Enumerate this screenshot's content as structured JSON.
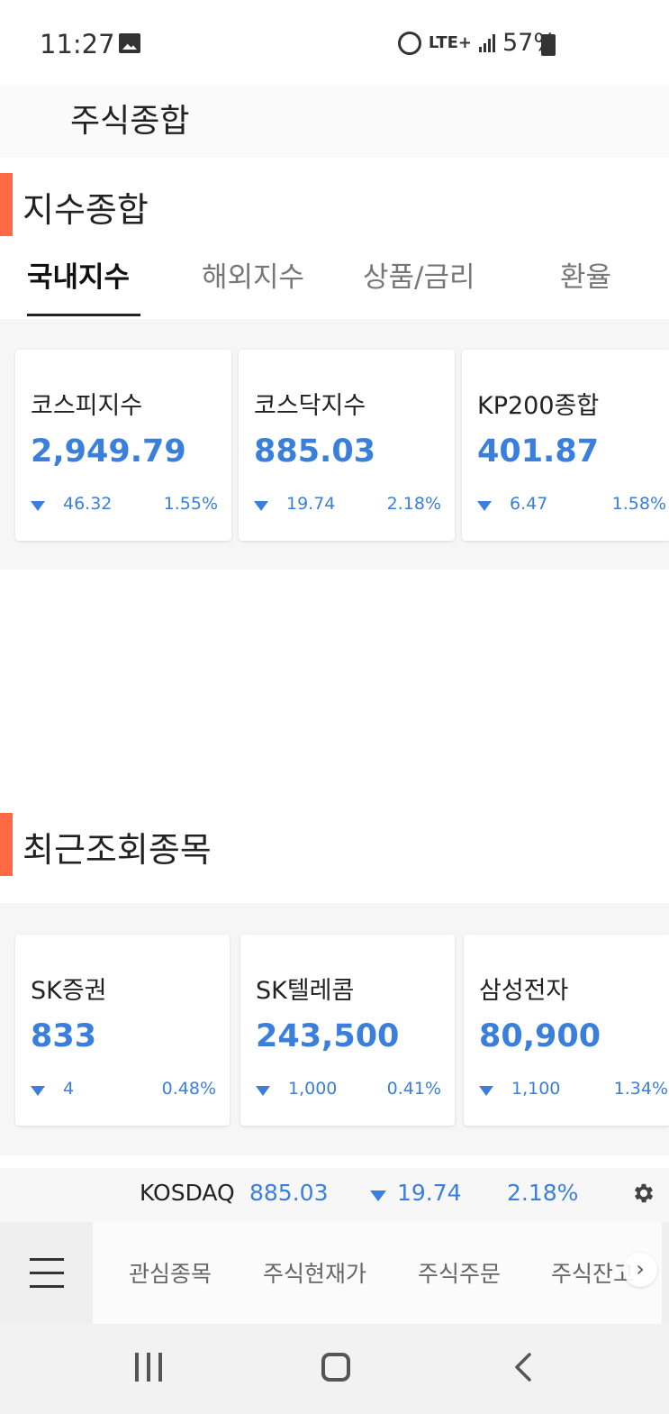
{
  "status_bar": {
    "time": "11:27",
    "network": "LTE+",
    "battery": "57%"
  },
  "header": {
    "title": "주식종합"
  },
  "index_section": {
    "title": "지수종합",
    "tabs": [
      "국내지수",
      "해외지수",
      "상품/금리",
      "환율"
    ],
    "active_tab": 0,
    "cards": [
      {
        "name": "코스피지수",
        "value": "2,949.79",
        "change": "46.32",
        "percent": "1.55%"
      },
      {
        "name": "코스닥지수",
        "value": "885.03",
        "change": "19.74",
        "percent": "2.18%"
      },
      {
        "name": "KP200종합",
        "value": "401.87",
        "change": "6.47",
        "percent": "1.58%"
      }
    ]
  },
  "recent_section": {
    "title": "최근조회종목",
    "cards": [
      {
        "name": "SK증권",
        "value": "833",
        "change": "4",
        "percent": "0.48%"
      },
      {
        "name": "SK텔레콤",
        "value": "243,500",
        "change": "1,000",
        "percent": "0.41%"
      },
      {
        "name": "삼성전자",
        "value": "80,900",
        "change": "1,100",
        "percent": "1.34%"
      }
    ]
  },
  "ticker": {
    "name": "KOSDAQ",
    "value": "885.03",
    "change": "19.74",
    "percent": "2.18%"
  },
  "bottom_nav": {
    "items": [
      "관심종목",
      "주식현재가",
      "주식주문",
      "주식잔고"
    ],
    "more_arrow": "›"
  },
  "colors": {
    "accent": "#ff6a45",
    "down_blue": "#3a7fdc"
  },
  "icons": [
    "image-icon",
    "alarm-icon",
    "signal-icon",
    "battery-icon",
    "gear-icon",
    "menu-icon",
    "recent-apps-icon",
    "home-icon",
    "back-icon"
  ]
}
